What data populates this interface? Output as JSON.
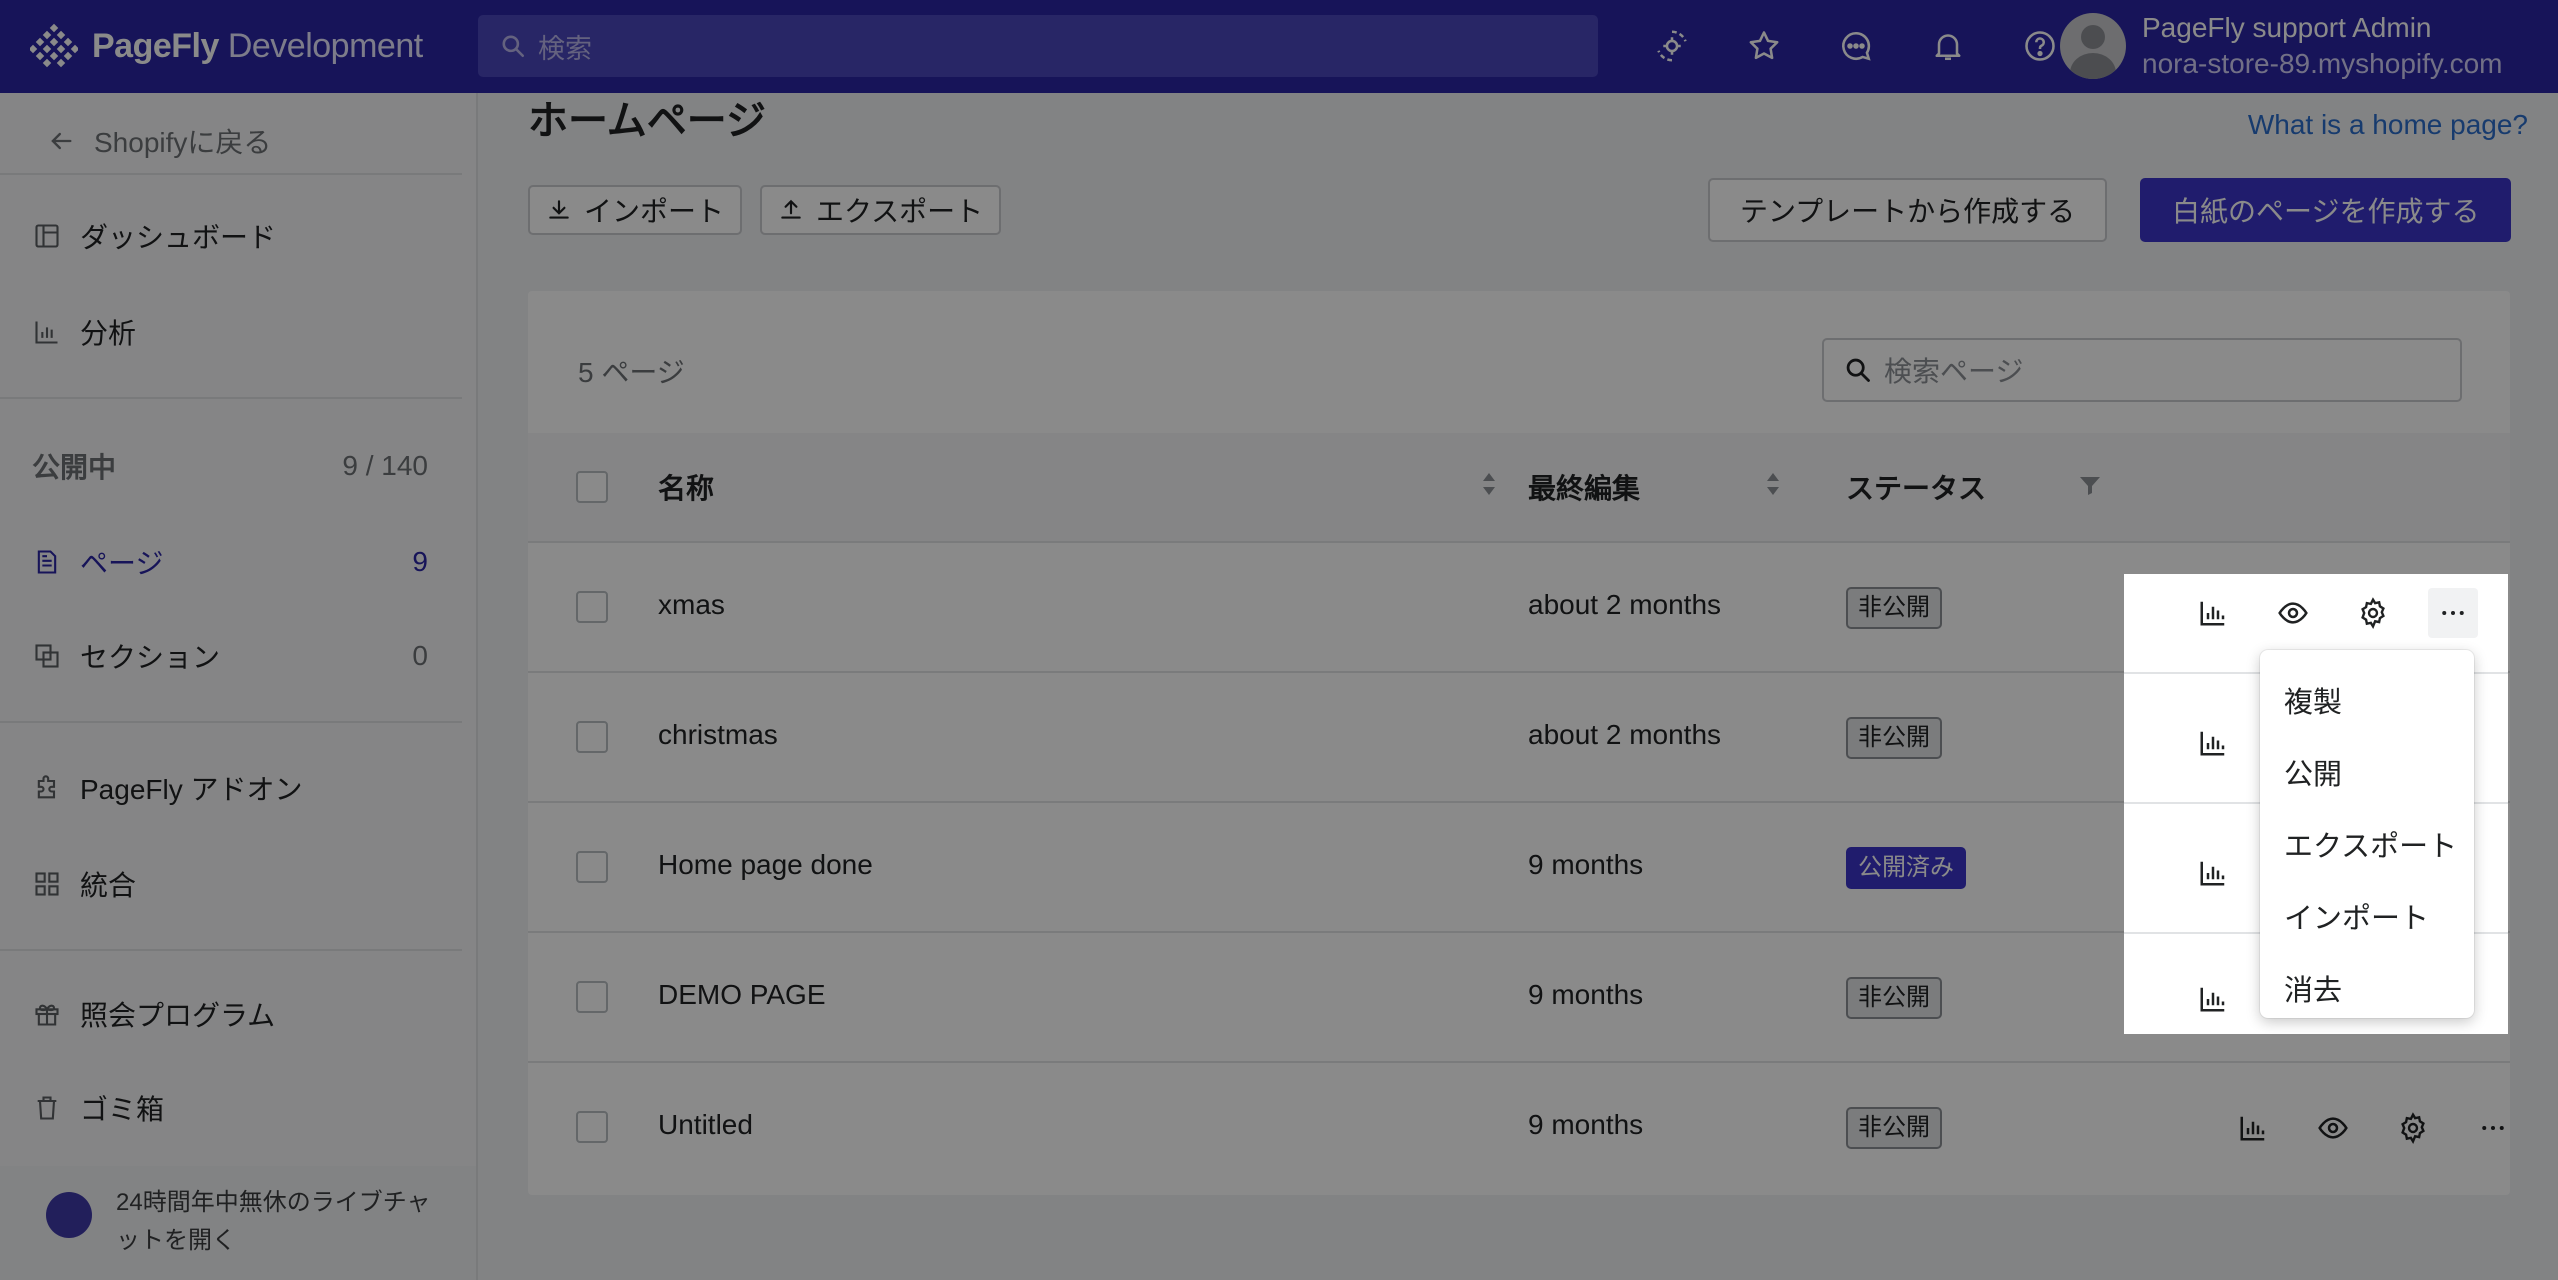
{
  "topbar": {
    "logo_name": "PageFly",
    "logo_suffix": "Development",
    "search_placeholder": "検索",
    "icons": [
      "settings-sync-icon",
      "star-icon",
      "chat-icon",
      "bell-icon",
      "help-icon"
    ],
    "user_name": "PageFly support Admin",
    "user_store": "nora-store-89.myshopify.com"
  },
  "sidebar": {
    "back_label": "Shopifyに戻る",
    "dashboard": "ダッシュボード",
    "analytics": "分析",
    "published_label": "公開中",
    "published_count": "9 / 140",
    "pages_label": "ページ",
    "pages_count": "9",
    "sections_label": "セクション",
    "sections_count": "0",
    "addons": "PageFly アドオン",
    "integrations": "統合",
    "referral": "照会プログラム",
    "trash": "ゴミ箱",
    "chat": "24時間年中無休のライブチャットを開く"
  },
  "main": {
    "title": "ホームページ",
    "help_link": "What is a home page?",
    "import_label": "インポート",
    "export_label": "エクスポート",
    "template_button": "テンプレートから作成する",
    "blank_button": "白紙のページを作成する",
    "page_count": "5 ページ",
    "search_placeholder": "検索ページ",
    "columns": {
      "name": "名称",
      "last_edit": "最終編集",
      "status": "ステータス"
    },
    "rows": [
      {
        "name": "xmas",
        "last_edit": "about 2 months",
        "status": "非公開"
      },
      {
        "name": "christmas",
        "last_edit": "about 2 months",
        "status": "非公開"
      },
      {
        "name": "Home page done",
        "last_edit": "9 months",
        "status": "公開済み"
      },
      {
        "name": "DEMO PAGE",
        "last_edit": "9 months",
        "status": "非公開"
      },
      {
        "name": "Untitled",
        "last_edit": "9 months",
        "status": "非公開"
      }
    ]
  },
  "menu": {
    "items": [
      "複製",
      "公開",
      "エクスポート",
      "インポート",
      "消去"
    ]
  },
  "colors": {
    "topbar": "#2b26a5",
    "primary": "#3b35c9",
    "link": "#2c6ecb"
  }
}
